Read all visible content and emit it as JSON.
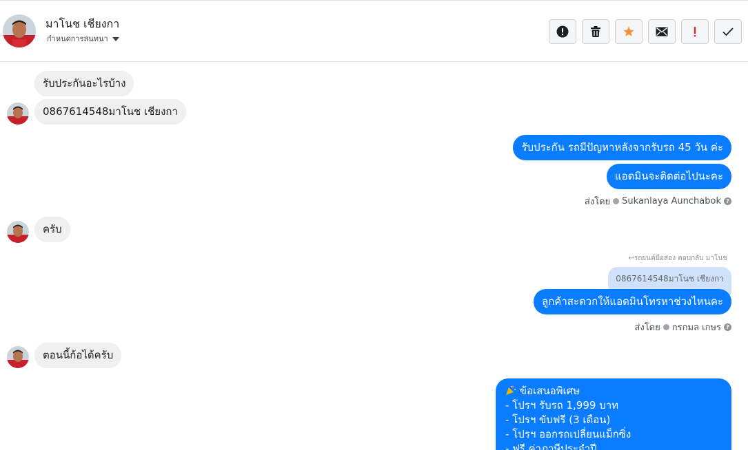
{
  "header": {
    "contact_name": "มาโนช เชียงกา",
    "subtitle": "กำหนดการสนทนา",
    "actions": [
      {
        "name": "report-button",
        "icon": "exclamation-circle-icon"
      },
      {
        "name": "delete-button",
        "icon": "trash-icon"
      },
      {
        "name": "star-button",
        "icon": "star-icon"
      },
      {
        "name": "mark-unread-button",
        "icon": "envelope-icon"
      },
      {
        "name": "important-button",
        "icon": "exclamation-icon"
      },
      {
        "name": "done-button",
        "icon": "checkmark-icon"
      }
    ]
  },
  "colors": {
    "outgoing": "#0a7cff",
    "incoming": "#f0f0f0",
    "star": "#f7923a",
    "important": "#e02424",
    "quoted": "#cfe1fb"
  },
  "messages": {
    "m1": "รับประกันอะไรบ้าง",
    "m2": "0867614548มาโนช   เชียงกา",
    "m3": "รับประกัน รถมีปัญหาหลังจากรับรถ 45 วัน ค่ะ",
    "m4": "แอดมินจะติดต่อไปนะคะ",
    "m5": "ครับ",
    "m6": "ลูกค้าสะดวกให้แอดมินโทรหาช่วงไหนคะ",
    "m7": "ตอนนี้ก้อได้ครับ"
  },
  "sent_by_1": {
    "prefix": "ส่งโดย",
    "name": "Sukanlaya Aunchabok"
  },
  "sent_by_2": {
    "prefix": "ส่งโดย",
    "name": "กรกมล เกษร"
  },
  "reply_hint": "รถยนต์มือสอง ตอบกลับ มาโนช",
  "quoted_text": "0867614548มาโนช เชียงกา",
  "offer": {
    "title": "ข้อเสนอพิเศษ",
    "lines": [
      "- โปรฯ รับรถ 1,999 บาท",
      "- โปรฯ ขับฟรี (3 เดือน)",
      "- โปรฯ ออกรถเปลี่ยนแม็กซิ่ง",
      "- ฟรี ค่าภาษีประจำปี"
    ]
  }
}
